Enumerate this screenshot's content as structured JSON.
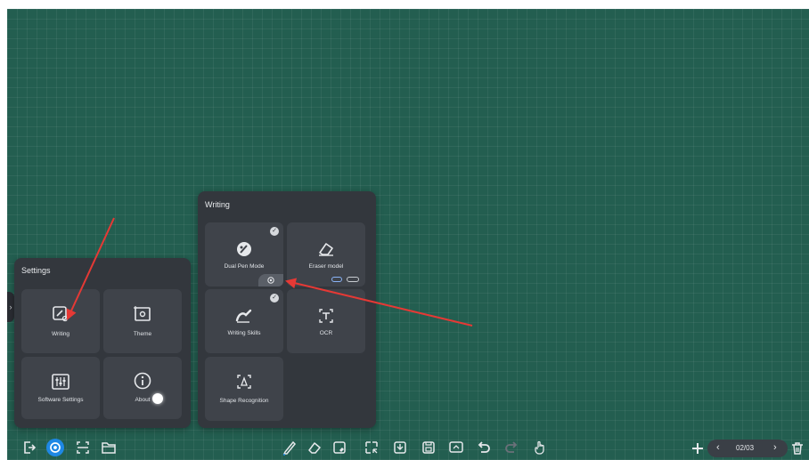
{
  "app": {
    "accent_color": "#1e88e5",
    "board_color": "#235e50",
    "annotation_color": "#e53935"
  },
  "settings_panel": {
    "title": "Settings",
    "tiles": [
      {
        "label": "Writing",
        "icon": "writing-settings-icon"
      },
      {
        "label": "Theme",
        "icon": "theme-icon"
      },
      {
        "label": "Software Settings",
        "icon": "sliders-icon"
      },
      {
        "label": "About",
        "icon": "info-icon"
      }
    ]
  },
  "writing_panel": {
    "title": "Writing",
    "tiles": [
      {
        "label": "Dual Pen Mode",
        "icon": "dual-pen-icon",
        "checked": true
      },
      {
        "label": "Eraser model",
        "icon": "eraser-icon"
      },
      {
        "label": "Writing Skills",
        "icon": "writing-skills-icon",
        "checked": true
      },
      {
        "label": "OCR",
        "icon": "ocr-icon"
      },
      {
        "label": "Shape Recognition",
        "icon": "shape-recognition-icon"
      }
    ],
    "check_glyph": "✓"
  },
  "bottom_toolbar": {
    "left": [
      "exit-icon",
      "settings-icon",
      "scan-icon",
      "folder-icon"
    ],
    "center": [
      "pen-icon",
      "eraser-icon",
      "clear-icon",
      "select-icon",
      "import-icon",
      "save-icon",
      "screen-icon",
      "undo-icon",
      "redo-icon",
      "hand-icon"
    ],
    "right": [
      "add-page-icon",
      "delete-icon"
    ]
  },
  "page_nav": {
    "prev": "‹",
    "current": "02/03",
    "next": "›"
  },
  "side_tab_glyph": "›"
}
